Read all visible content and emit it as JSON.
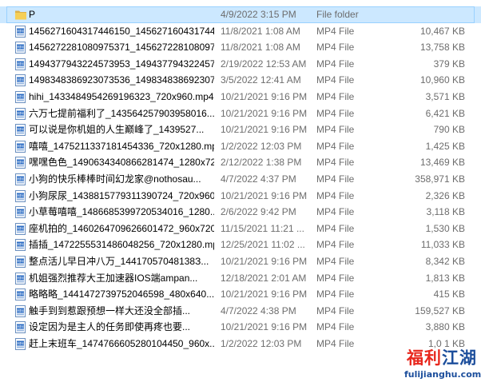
{
  "files": [
    {
      "name": "P",
      "date": "4/9/2022 3:15 PM",
      "type": "File folder",
      "size": "",
      "icon": "folder-icon",
      "selected": true
    },
    {
      "name": "1456271604317446150_1456271604317446...",
      "date": "11/8/2021 1:08 AM",
      "type": "MP4 File",
      "size": "10,467 KB",
      "icon": "mp4-file-icon"
    },
    {
      "name": "1456272281080975371_1456272281080975...",
      "date": "11/8/2021 1:08 AM",
      "type": "MP4 File",
      "size": "13,758 KB",
      "icon": "mp4-file-icon"
    },
    {
      "name": "1494377943224573953_1494377943224573...",
      "date": "2/19/2022 12:53 AM",
      "type": "MP4 File",
      "size": "379 KB",
      "icon": "mp4-file-icon"
    },
    {
      "name": "1498348386923073536_1498348386923073...",
      "date": "3/5/2022 12:41 AM",
      "type": "MP4 File",
      "size": "10,960 KB",
      "icon": "mp4-file-icon"
    },
    {
      "name": "hihi_1433484954269196323_720x960.mp4",
      "date": "10/21/2021 9:16 PM",
      "type": "MP4 File",
      "size": "3,571 KB",
      "icon": "mp4-file-icon"
    },
    {
      "name": "六万七提前福利了_143564257903958016...",
      "date": "10/21/2021 9:16 PM",
      "type": "MP4 File",
      "size": "6,421 KB",
      "icon": "mp4-file-icon"
    },
    {
      "name": "可以说是你机姐的人生巅峰了_1439527...",
      "date": "10/21/2021 9:16 PM",
      "type": "MP4 File",
      "size": "790 KB",
      "icon": "mp4-file-icon"
    },
    {
      "name": "嘻嘻_1475211337181454336_720x1280.mp4",
      "date": "1/2/2022 12:03 PM",
      "type": "MP4 File",
      "size": "1,425 KB",
      "icon": "mp4-file-icon"
    },
    {
      "name": "嘿嘿色色_1490634340866281474_1280x72...",
      "date": "2/12/2022 1:38 PM",
      "type": "MP4 File",
      "size": "13,469 KB",
      "icon": "mp4-file-icon"
    },
    {
      "name": "小狗的快乐棒棒时间幻龙家@nothosau...",
      "date": "4/7/2022 4:37 PM",
      "type": "MP4 File",
      "size": "358,971 KB",
      "icon": "mp4-file-icon"
    },
    {
      "name": "小狗尿尿_1438815779311390724_720x960...",
      "date": "10/21/2021 9:16 PM",
      "type": "MP4 File",
      "size": "2,326 KB",
      "icon": "mp4-file-icon"
    },
    {
      "name": "小草莓嘻嘻_1486685399720534016_1280...",
      "date": "2/6/2022 9:42 PM",
      "type": "MP4 File",
      "size": "3,118 KB",
      "icon": "mp4-file-icon"
    },
    {
      "name": "座机拍的_1460264709626601472_960x720...",
      "date": "11/15/2021 11:21 ...",
      "type": "MP4 File",
      "size": "1,530 KB",
      "icon": "mp4-file-icon"
    },
    {
      "name": "插插_1472255531486048256_720x1280.mp4",
      "date": "12/25/2021 11:02 ...",
      "type": "MP4 File",
      "size": "11,033 KB",
      "icon": "mp4-file-icon"
    },
    {
      "name": "整点活儿早日冲八万_14417057048138З...",
      "date": "10/21/2021 9:16 PM",
      "type": "MP4 File",
      "size": "8,342 KB",
      "icon": "mp4-file-icon"
    },
    {
      "name": "机姐强烈推荐大王加速器IOS端ampan...",
      "date": "12/18/2021 2:01 AM",
      "type": "MP4 File",
      "size": "1,813 KB",
      "icon": "mp4-file-icon"
    },
    {
      "name": "略略略_1441472739752046598_480x640....",
      "date": "10/21/2021 9:16 PM",
      "type": "MP4 File",
      "size": "415 KB",
      "icon": "mp4-file-icon"
    },
    {
      "name": "触手到到惹跟预想一样大还没全部插...",
      "date": "4/7/2022 4:38 PM",
      "type": "MP4 File",
      "size": "159,527 KB",
      "icon": "mp4-file-icon"
    },
    {
      "name": "设定因为是主人的任务即使再疼也要...",
      "date": "10/21/2021 9:16 PM",
      "type": "MP4 File",
      "size": "3,880 KB",
      "icon": "mp4-file-icon"
    },
    {
      "name": "赶上末班车_1474766605280104450_960x...",
      "date": "1/2/2022 12:03 PM",
      "type": "MP4 File",
      "size": "1,0 1 KB",
      "icon": "mp4-file-icon"
    }
  ],
  "watermark": {
    "main": "福利江湖",
    "sub": "fulijianghu.com",
    "colors": [
      "#e8281e",
      "#e8281e",
      "#1c4e9c",
      "#1c4e9c"
    ]
  },
  "colors": {
    "selection": "#cce8ff",
    "selection_border": "#99d1ff",
    "folder": "#f2c94c",
    "detail_text": "#6d6d6d"
  }
}
